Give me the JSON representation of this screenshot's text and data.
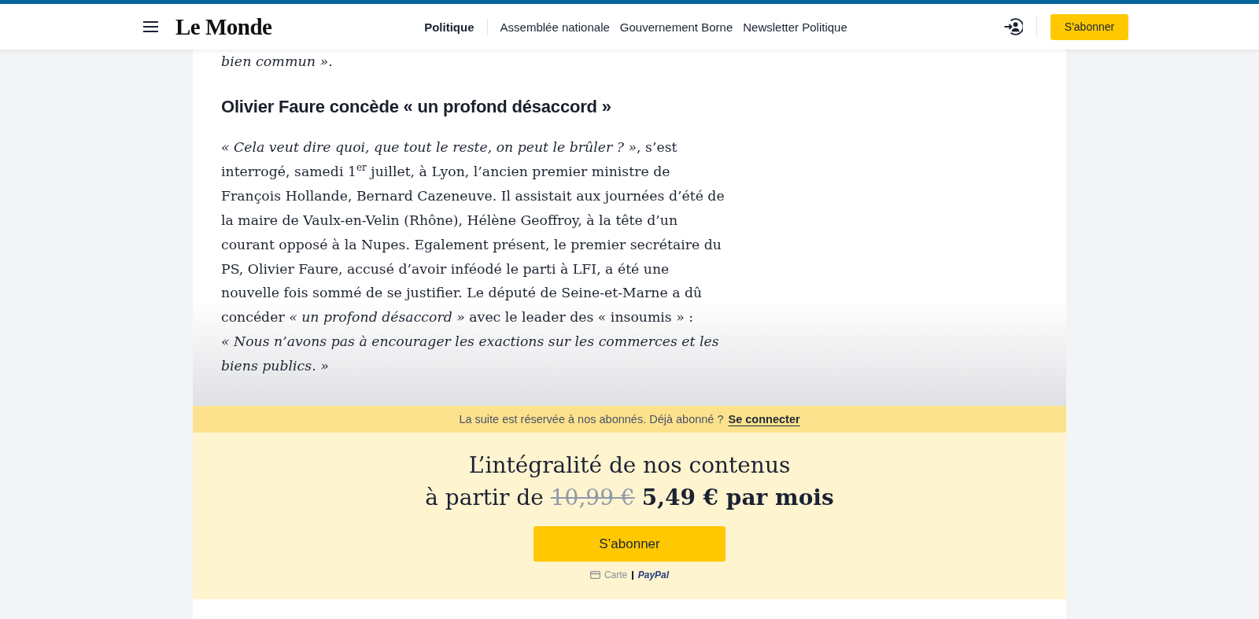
{
  "header": {
    "logo": "Le Monde",
    "nav": [
      {
        "label": "Politique",
        "selected": true
      },
      {
        "label": "Assemblée nationale",
        "selected": false
      },
      {
        "label": "Gouvernement Borne",
        "selected": false
      },
      {
        "label": "Newsletter Politique",
        "selected": false
      }
    ],
    "subscribe_button": "S'abonner"
  },
  "article": {
    "lead_out": "*bien commun »*.",
    "heading": "Olivier Faure concède « un profond désaccord »",
    "paragraph": "*« Cela veut dire quoi, que tout le reste, on peut le brûler ? »*, s’est interrogé, samedi 1$^{er}$ juillet, à Lyon, l’ancien premier ministre de François Hollande, Bernard Cazeneuve. Il assistait aux journées d’été de la maire de Vaulx-en-Velin (Rhône), Hélène Geoffroy, à la tête d’un courant opposé à la Nupes. Egalement présent, le premier secrétaire du PS, Olivier Faure, accusé d’avoir inféodé le parti à LFI, a été une nouvelle fois sommé de se justifier. Le député de Seine-et-Marne a dû concéder *« un profond désaccord »* avec le leader des « insoumis » : *« Nous n’avons pas à encourager les exactions sur les commerces et les biens publics. »*"
  },
  "paywall": {
    "notice": "La suite est réservée à nos abonnés. Déjà abonné ?",
    "login_link": "Se connecter",
    "headline": "L’intégralité de nos contenus",
    "price_prefix": "à partir de",
    "old_price": "10,99 €",
    "new_price": "5,49 € par mois",
    "subscribe_button": "S’abonner",
    "payment_methods": [
      {
        "kind": "card",
        "label": "Carte"
      },
      {
        "kind": "paypal",
        "label": "PayPal"
      }
    ]
  }
}
